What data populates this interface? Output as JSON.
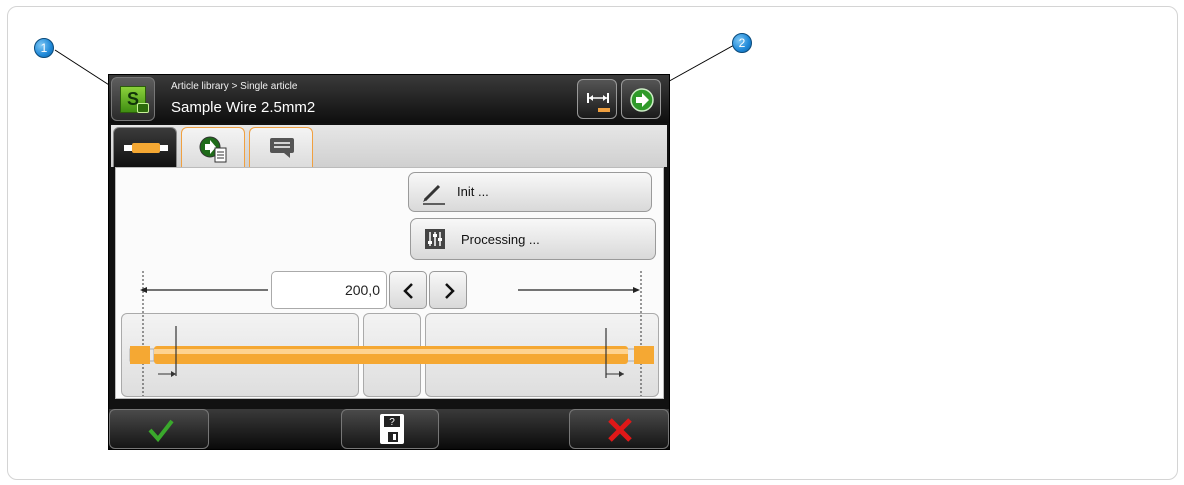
{
  "callouts": [
    "1",
    "2"
  ],
  "header": {
    "breadcrumb": "Article library > Single article",
    "title": "Sample Wire 2.5mm2",
    "app_icon_letter": "S"
  },
  "tabs": [
    {
      "icon": "wire-icon",
      "active": true
    },
    {
      "icon": "process-list-icon",
      "active": false
    },
    {
      "icon": "comment-icon",
      "active": false
    }
  ],
  "buttons": {
    "init": "Init ...",
    "processing": "Processing ..."
  },
  "length": {
    "value": "200,0"
  },
  "colors": {
    "wire": "#f5a833",
    "accent": "#f0a040",
    "ok": "#3aa82c",
    "cancel": "#e01818"
  },
  "footer_icons": [
    "checkmark-icon",
    "save-question-icon",
    "close-icon"
  ]
}
